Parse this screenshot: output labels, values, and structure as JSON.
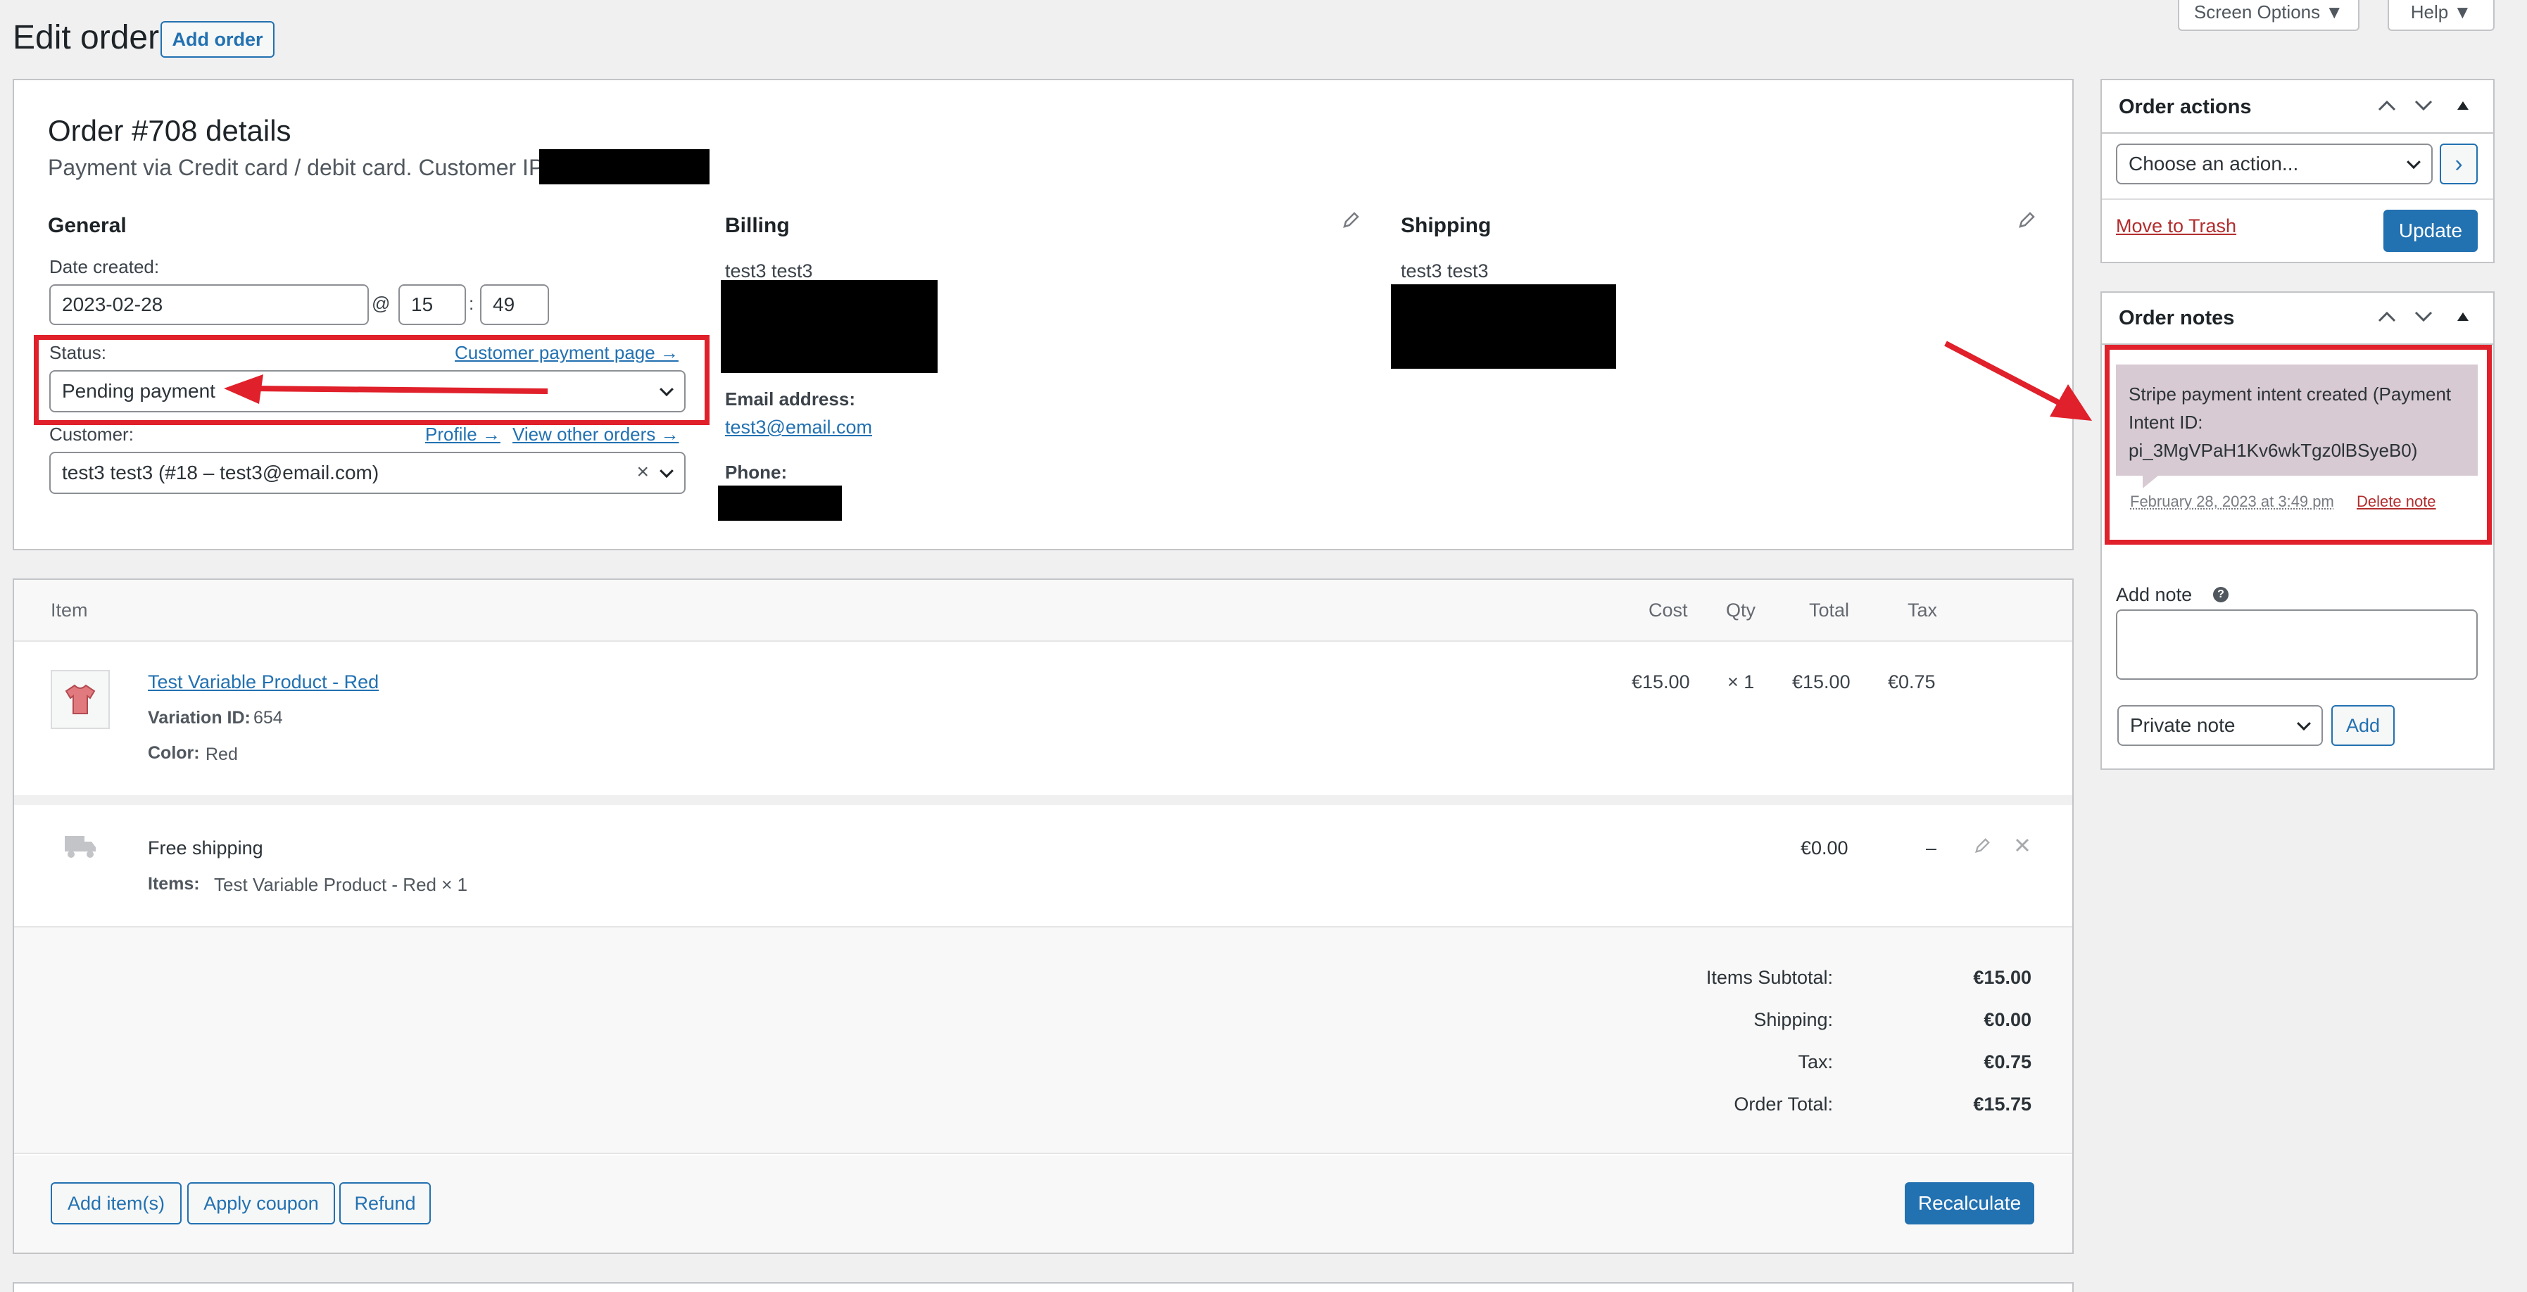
{
  "header": {
    "title": "Edit order",
    "add_order": "Add order",
    "screen_options": "Screen Options ▼",
    "help": "Help ▼"
  },
  "order": {
    "heading": "Order #708 details",
    "payment_line": "Payment via Credit card / debit card. Customer IP:",
    "general_title": "General",
    "date_label": "Date created:",
    "date_value": "2023-02-28",
    "at_symbol": "@",
    "hour": "15",
    "colon": ":",
    "minute": "49",
    "status_label": "Status:",
    "customer_payment_page": "Customer payment page →",
    "status_value": "Pending payment",
    "customer_label": "Customer:",
    "profile_link": "Profile →",
    "other_orders_link": "View other orders →",
    "customer_value": "test3 test3 (#18 – test3@email.com)",
    "clear_symbol": "×"
  },
  "billing": {
    "title": "Billing",
    "name": "test3 test3",
    "email_label": "Email address:",
    "email": "test3@email.com",
    "phone_label": "Phone:"
  },
  "shipping": {
    "title": "Shipping",
    "name": "test3 test3"
  },
  "items": {
    "columns": {
      "item": "Item",
      "cost": "Cost",
      "qty": "Qty",
      "total": "Total",
      "tax": "Tax"
    },
    "product": {
      "name": "Test Variable Product - Red",
      "variation_label": "Variation ID:",
      "variation_value": "654",
      "color_label": "Color:",
      "color_value": "Red",
      "cost": "€15.00",
      "qty": "× 1",
      "total": "€15.00",
      "tax": "€0.75"
    },
    "shipping_line": {
      "name": "Free shipping",
      "items_label": "Items:",
      "items_value": "Test Variable Product - Red × 1",
      "total": "€0.00",
      "tax": "–"
    }
  },
  "totals": {
    "subtotal_label": "Items Subtotal:",
    "subtotal": "€15.00",
    "shipping_label": "Shipping:",
    "shipping": "€0.00",
    "tax_label": "Tax:",
    "tax": "€0.75",
    "order_total_label": "Order Total:",
    "order_total": "€15.75"
  },
  "actions_row": {
    "add_items": "Add item(s)",
    "apply_coupon": "Apply coupon",
    "refund": "Refund",
    "recalculate": "Recalculate"
  },
  "order_actions": {
    "title": "Order actions",
    "select_value": "Choose an action...",
    "go": "›",
    "trash": "Move to Trash",
    "update": "Update"
  },
  "order_notes": {
    "title": "Order notes",
    "note_text": "Stripe payment intent created (Payment Intent ID: pi_3MgVPaH1Kv6wkTgz0lBSyeB0)",
    "note_meta": "February 28, 2023 at 3:49 pm",
    "delete_note": "Delete note",
    "add_note_label": "Add note",
    "help_glyph": "?",
    "note_type": "Private note",
    "add_button": "Add"
  },
  "colors": {
    "accent": "#2271b1",
    "annotation_red": "#e0202a",
    "note_bg": "#d7cad2",
    "trash": "#b32d2e"
  }
}
